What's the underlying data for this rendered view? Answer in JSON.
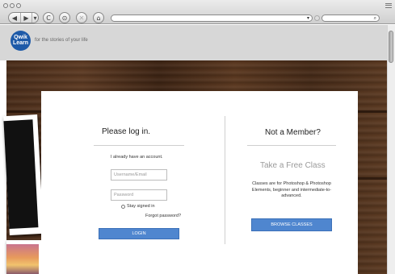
{
  "browser": {
    "nav_back": "◀",
    "nav_forward": "▶",
    "nav_menu": "▾",
    "reload": "C",
    "stop": "⊙",
    "close": "✕",
    "home": "⌂",
    "url_value": "",
    "url_dropdown": "▾",
    "search_value": "",
    "search_glyph": "⌕"
  },
  "header": {
    "logo_line1": "Qwik",
    "logo_line2": "Learn",
    "tagline": "for the stories of your life",
    "brand_color": "#1e5aa8"
  },
  "login": {
    "heading": "Please log in.",
    "have_account": "I already have an account.",
    "username_placeholder": "Username/Email",
    "password_placeholder": "Password",
    "stay_signed_in": "Stay signed in",
    "forgot_password": "Forgot password?",
    "login_button": "LOGIN"
  },
  "member": {
    "heading": "Not a Member?",
    "free_class": "Take a Free Class",
    "description": "Classes are for Photoshop & Photoshop Elements, beginner and intermediate-to-advanced.",
    "browse_button": "BROWSE CLASSES"
  },
  "colors": {
    "button": "#4f86cf",
    "wood": "#4a2d1a"
  }
}
